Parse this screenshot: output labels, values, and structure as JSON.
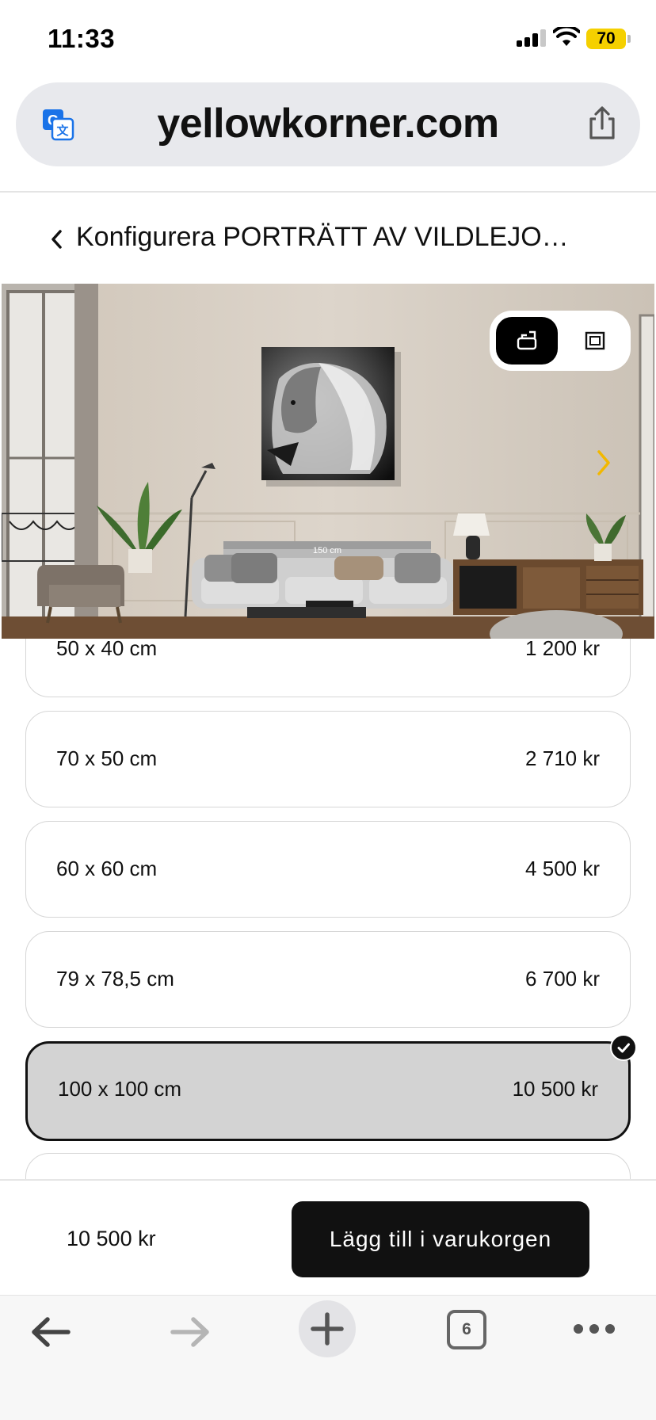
{
  "status_bar": {
    "time": "11:33",
    "battery": "70"
  },
  "browser": {
    "url": "yellowkorner.com",
    "tab_count": "6"
  },
  "page": {
    "title": "Konfigurera PORTRÄTT AV VILDLEJO…"
  },
  "preview": {
    "sofa_width_label": "150 cm"
  },
  "size_options": [
    {
      "label": "50 x 40 cm",
      "price": "1 200 kr",
      "selected": false
    },
    {
      "label": "70 x 50 cm",
      "price": "2 710 kr",
      "selected": false
    },
    {
      "label": "60 x 60 cm",
      "price": "4 500 kr",
      "selected": false
    },
    {
      "label": "79 x 78,5 cm",
      "price": "6 700 kr",
      "selected": false
    },
    {
      "label": "100 x 100 cm",
      "price": "10 500 kr",
      "selected": true
    }
  ],
  "purchase": {
    "total": "10 500 kr",
    "add_to_cart_label": "Lägg till i varukorgen"
  },
  "icons": {
    "translate": "translate-icon",
    "share": "share-icon",
    "back": "chevron-left-icon",
    "view_in_room": "room-view-icon",
    "view_framed": "framed-view-icon",
    "next": "chevron-right-icon",
    "check": "check-icon"
  },
  "colors": {
    "accent_yellow": "#f5d000",
    "button_dark": "#111111",
    "selected_bg": "#d3d3d3",
    "link_blue": "#1a73e8"
  }
}
